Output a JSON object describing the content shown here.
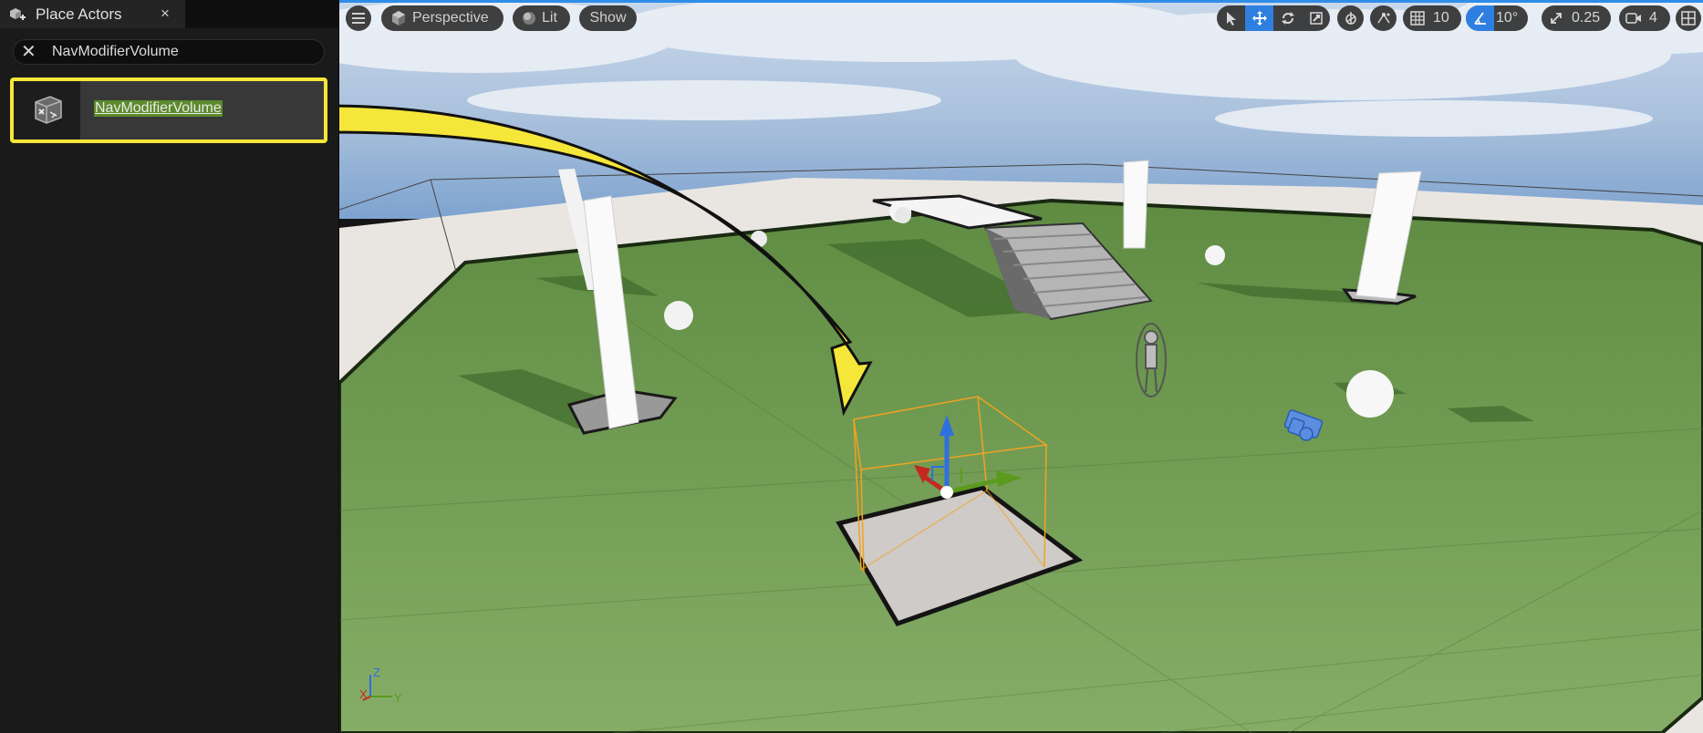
{
  "panel": {
    "tab_title": "Place Actors",
    "tab_close": "×",
    "search": {
      "clear": "✕",
      "value": "NavModifierVolume",
      "placeholder": ""
    },
    "results": [
      {
        "label": "NavModifierVolume"
      }
    ]
  },
  "viewport": {
    "view_mode": "Perspective",
    "lighting_mode": "Lit",
    "show_label": "Show",
    "grid_snap_value": "10",
    "rotation_snap_value": "10°",
    "scale_snap_value": "0.25",
    "camera_speed_value": "4",
    "axis": {
      "z": "Z",
      "x": "X",
      "y": "Y"
    }
  },
  "colors": {
    "highlight_yellow": "#f5e63a",
    "selection_green": "#5c8a2c",
    "active_blue": "#2f7fe0",
    "ground_green": "#6f9a4e",
    "bounds_orange": "#f5a623"
  }
}
